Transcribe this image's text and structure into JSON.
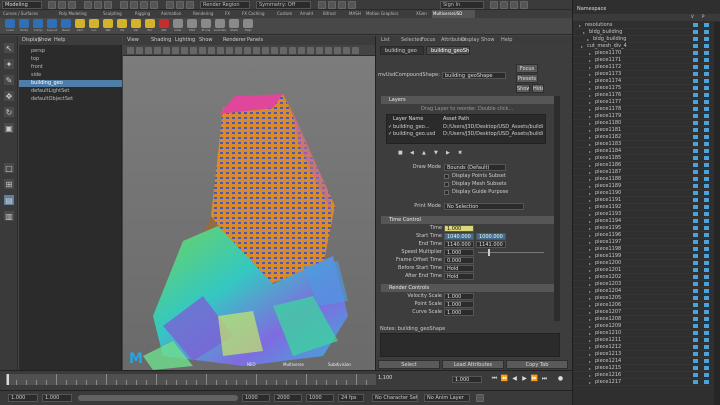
{
  "status_line": {
    "mode": "Modeling",
    "render_field": "Render Region",
    "symmetry": "Symmetry: Off",
    "sign_in": "Sign In"
  },
  "shelf": {
    "tabs": [
      "Curves / Surfaces",
      "Poly Modeling",
      "Sculpting",
      "Rigging",
      "Animation",
      "Rendering",
      "FX",
      "FX Caching",
      "Custom",
      "Arnold",
      "Bifrost",
      "MASH",
      "Motion Graphics",
      "XGen",
      "MultiverseUSD"
    ],
    "active_tab": "MultiverseUSD",
    "items": [
      {
        "label": "Load",
        "color": "#2f6fb8"
      },
      {
        "label": "Write",
        "color": "#2f6fb8"
      },
      {
        "label": "Comp",
        "color": "#2f6fb8"
      },
      {
        "label": "Layout",
        "color": "#2f6fb8"
      },
      {
        "label": "Read",
        "color": "#2f6fb8"
      },
      {
        "label": "Asm",
        "color": "#d4b22a"
      },
      {
        "label": "Loc",
        "color": "#d4b22a"
      },
      {
        "label": "Ref",
        "color": "#d4b22a"
      },
      {
        "label": "Vis",
        "color": "#d4b22a"
      },
      {
        "label": "Var",
        "color": "#d4b22a"
      },
      {
        "label": "Pur",
        "color": "#d4b22a"
      },
      {
        "label": "Attr",
        "color": "#c42e2e"
      },
      {
        "label": "Over",
        "color": "#8a8a8a"
      },
      {
        "label": "Mat",
        "color": "#8a8a8a"
      },
      {
        "label": "Prune",
        "color": "#8a8a8a"
      },
      {
        "label": "Lookdev",
        "color": "#8a8a8a"
      },
      {
        "label": "Stats",
        "color": "#8a8a8a"
      },
      {
        "label": "Help",
        "color": "#8a8a8a"
      }
    ]
  },
  "outliner": {
    "menus": [
      "Display",
      "Show",
      "Help"
    ],
    "items": [
      "persp",
      "top",
      "front",
      "side",
      "building_geo",
      "defaultLightSet",
      "defaultObjectSet"
    ],
    "selected_index": 4
  },
  "viewport": {
    "menus": [
      "View",
      "Shading",
      "Lighting",
      "Show",
      "Renderer",
      "Panels"
    ],
    "hud_left": "NEO",
    "hud_center": "Multiverse",
    "hud_right": "Subdivision",
    "logo": "M"
  },
  "attribute_editor": {
    "top_tabs": [
      "List",
      "Selected",
      "Focus",
      "Attributes",
      "Display",
      "Show",
      "Help"
    ],
    "sub_tabs": [
      "building_geo",
      "building_geoShape"
    ],
    "active_sub_tab": "building_geoShape",
    "node_label": "mvUsdCompoundShape:",
    "node_value": "building_geoShape",
    "focus_label": "Focus",
    "presets_label": "Presets",
    "show_label": "Show",
    "hide_label": "Hide",
    "layers_section": "Layers",
    "layers_hint": "Drag Layer to reorder. Double click...",
    "layers_cols": [
      "Layer Name",
      "Asset Path"
    ],
    "layers_rows": [
      {
        "name": "building_geo...",
        "path": "D:/Users/J3D/Desktop/USD_Assets/building..."
      },
      {
        "name": "building_geo.usd",
        "path": "D:/Users/J3D/Desktop/USD_Assets/building..."
      }
    ],
    "draw_mode_label": "Draw Mode",
    "draw_mode_value": "Bounds (Default)",
    "checks": [
      "Display Points Subset",
      "Display Mesh Subsets",
      "Display Guide Purpose"
    ],
    "print_mode_label": "Print Mode",
    "print_mode_value": "No Selection",
    "time_section": "Time Control",
    "time_rows": [
      {
        "label": "Time",
        "value": "1.000",
        "style": "key"
      },
      {
        "label": "Start Time",
        "value": "1040.000",
        "value2": "1000.000",
        "style": "conn"
      },
      {
        "label": "End Time",
        "value": "1140.000",
        "value2": "1141.000",
        "style": "plain"
      },
      {
        "label": "Speed Multiplier",
        "value": "1.000",
        "style": "plain"
      },
      {
        "label": "Frame Offset Time",
        "value": "0.000",
        "style": "plain"
      },
      {
        "label": "Before Start Time",
        "value": "Hold",
        "style": "plain"
      },
      {
        "label": "After End Time",
        "value": "Hold",
        "style": "plain"
      }
    ],
    "render_section": "Render Controls",
    "render_rows": [
      {
        "label": "Velocity Scale",
        "value": "1.000"
      },
      {
        "label": "Point Scale",
        "value": "1.000"
      },
      {
        "label": "Curve Scale",
        "value": "1.000"
      }
    ],
    "notes_label": "Notes: building_geoShape",
    "bottom_buttons": [
      "Select",
      "Load Attributes",
      "Copy Tab"
    ]
  },
  "channel_box": {
    "title": "Namespace",
    "top_rows": [
      "resolutions",
      "bldg_building",
      "bldg_building"
    ],
    "root_row": "cut_mesh_div_4",
    "pieces": [
      "piece1170",
      "piece1171",
      "piece1172",
      "piece1173",
      "piece1174",
      "piece1175",
      "piece1176",
      "piece1177",
      "piece1178",
      "piece1179",
      "piece1180",
      "piece1181",
      "piece1182",
      "piece1183",
      "piece1184",
      "piece1185",
      "piece1186",
      "piece1187",
      "piece1188",
      "piece1189",
      "piece1190",
      "piece1191",
      "piece1192",
      "piece1193",
      "piece1194",
      "piece1195",
      "piece1196",
      "piece1197",
      "piece1198",
      "piece1199",
      "piece1200",
      "piece1201",
      "piece1202",
      "piece1203",
      "piece1204",
      "piece1205",
      "piece1206",
      "piece1207",
      "piece1208",
      "piece1209",
      "piece1210",
      "piece1211",
      "piece1212",
      "piece1213",
      "piece1214",
      "piece1215",
      "piece1216",
      "piece1217"
    ],
    "vis_color": "#4aa3d9"
  },
  "time_slider": {
    "current_frame": "1000",
    "frame_field": "1.000",
    "end_marker": "1,100"
  },
  "range_slider": {
    "start": "1.000",
    "range_start": "1.000",
    "range_end": "1000",
    "end": "2000",
    "fps_start": "1000",
    "fps": "24 fps",
    "character": "No Character Set",
    "anim_layer": "No Anim Layer"
  },
  "logo": {
    "letter": "M",
    "color": "#25a6e0"
  }
}
